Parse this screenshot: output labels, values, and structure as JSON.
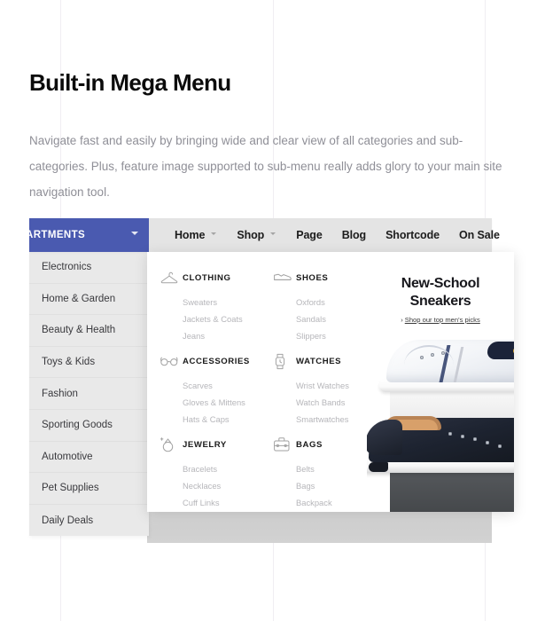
{
  "intro": {
    "heading": "Built-in Mega Menu",
    "body": "Navigate fast and easily by bringing wide and clear view of all categories and sub-categories. Plus, feature image supported to sub-menu really adds glory to your main site navigation tool."
  },
  "navbar": {
    "departments_label": "ARTMENTS",
    "departments_color": "#4a5ab0",
    "background_color": "#e4e4e4",
    "items": [
      {
        "label": "Home",
        "has_caret": true
      },
      {
        "label": "Shop",
        "has_caret": true
      },
      {
        "label": "Page",
        "has_caret": false
      },
      {
        "label": "Blog",
        "has_caret": false
      },
      {
        "label": "Shortcode",
        "has_caret": false
      },
      {
        "label": "On Sale",
        "has_caret": false
      }
    ]
  },
  "sidebar": {
    "items": [
      {
        "label": "Electronics"
      },
      {
        "label": "Home & Garden"
      },
      {
        "label": "Beauty & Health"
      },
      {
        "label": "Toys & Kids"
      },
      {
        "label": "Fashion"
      },
      {
        "label": "Sporting Goods"
      },
      {
        "label": "Automotive"
      },
      {
        "label": "Pet Supplies"
      },
      {
        "label": "Daily Deals"
      }
    ]
  },
  "mega_menu": {
    "columns": [
      {
        "groups": [
          {
            "title": "CLOTHING",
            "icon": "hanger-icon",
            "links": [
              "Sweaters",
              "Jackets & Coats",
              "Jeans"
            ]
          },
          {
            "title": "ACCESSORIES",
            "icon": "glasses-icon",
            "links": [
              "Scarves",
              "Gloves & Mittens",
              "Hats & Caps"
            ]
          },
          {
            "title": "JEWELRY",
            "icon": "ring-icon",
            "links": [
              "Bracelets",
              "Necklaces",
              "Cuff Links"
            ]
          }
        ]
      },
      {
        "groups": [
          {
            "title": "SHOES",
            "icon": "shoe-icon",
            "links": [
              "Oxfords",
              "Sandals",
              "Slippers"
            ]
          },
          {
            "title": "WATCHES",
            "icon": "watch-icon",
            "links": [
              "Wrist Watches",
              "Watch Bands",
              "Smartwatches"
            ]
          },
          {
            "title": "BAGS",
            "icon": "briefcase-icon",
            "links": [
              "Belts",
              "Bags",
              "Backpack"
            ]
          }
        ]
      }
    ],
    "promo": {
      "title_line1": "New-School",
      "title_line2": "Sneakers",
      "link_chevron": "›",
      "link_text": "Shop our top men's picks",
      "image_alt": "two mens sneakers white and navy on a grey display platform"
    }
  }
}
